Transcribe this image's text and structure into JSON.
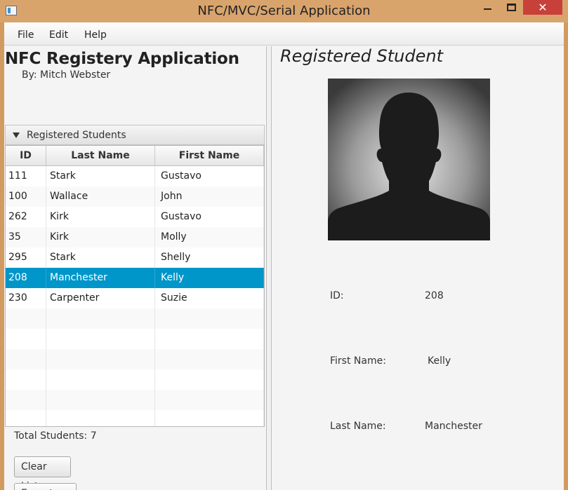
{
  "window": {
    "title": "NFC/MVC/Serial Application",
    "close_glyph": "✕"
  },
  "menu": [
    "File",
    "Edit",
    "Help"
  ],
  "left": {
    "app_title": "NFC Registery Application",
    "author": "By: Mitch Webster",
    "pane_title": "Registered Students",
    "columns": [
      "ID",
      "Last Name",
      "First Name"
    ],
    "rows": [
      [
        "111",
        "Stark",
        "Gustavo"
      ],
      [
        "100",
        "Wallace",
        "John"
      ],
      [
        "262",
        "Kirk",
        "Gustavo"
      ],
      [
        "35",
        "Kirk",
        "Molly"
      ],
      [
        "295",
        "Stark",
        "Shelly"
      ],
      [
        "208",
        "Manchester",
        "Kelly"
      ],
      [
        "230",
        "Carpenter",
        "Suzie"
      ]
    ],
    "selected_row": 5,
    "total": "Total Students: 7",
    "clear_button": "Clear List",
    "export_button": "Export List"
  },
  "right": {
    "title": "Registered Student",
    "id_label": "ID:",
    "id_value": "208",
    "first_label": "First Name:",
    "first_value": "Kelly",
    "last_label": "Last Name:",
    "last_value": "Manchester"
  },
  "colors": {
    "selection": "#0096c9",
    "titlebar": "#d9a46c",
    "close": "#c7413a"
  }
}
